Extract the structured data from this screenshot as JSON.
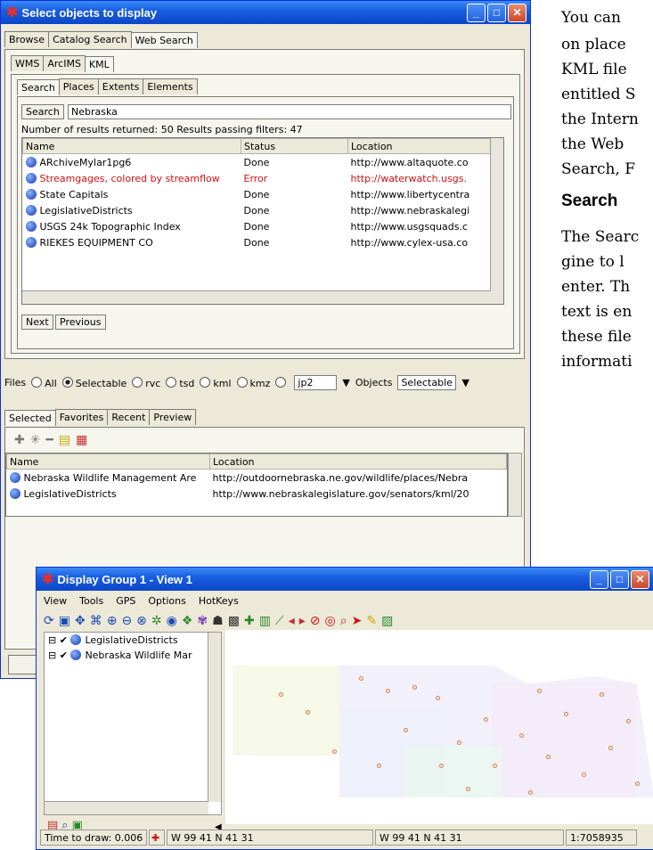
{
  "doc": {
    "lines": [
      "You can",
      "on place",
      "KML file",
      "entitled S",
      "the Intern",
      "the Web",
      "Search, F"
    ],
    "heading": "Search",
    "para": [
      "The Searc",
      "gine to l",
      "enter. Th",
      "text is en",
      "these file",
      "informati"
    ]
  },
  "win1": {
    "title": "Select objects to display",
    "tabs": [
      "Browse",
      "Catalog Search",
      "Web Search"
    ],
    "subtabs": [
      "WMS",
      "ArcIMS",
      "KML"
    ],
    "kmltabs": [
      "Search",
      "Places",
      "Extents",
      "Elements"
    ],
    "search_button": "Search",
    "search_value": "Nebraska",
    "results_info": "Number of results returned: 50   Results passing filters: 47",
    "columns": [
      "Name",
      "Status",
      "Location"
    ],
    "rows": [
      {
        "name": "ARchiveMylar1pg6",
        "status": "Done",
        "location": "http://www.altaquote.co"
      },
      {
        "name": "Streamgages, colored by streamflow",
        "status": "Error",
        "location": "http://waterwatch.usgs."
      },
      {
        "name": "State Capitals",
        "status": "Done",
        "location": "http://www.libertycentra"
      },
      {
        "name": "LegislativeDistricts",
        "status": "Done",
        "location": "http://www.nebraskalegi"
      },
      {
        "name": "USGS 24k Topographic Index",
        "status": "Done",
        "location": "http://www.usgsquads.c"
      },
      {
        "name": "RIEKES EQUIPMENT CO",
        "status": "Done",
        "location": "http://www.cylex-usa.co"
      }
    ],
    "next": "Next",
    "previous": "Previous",
    "files_label": "Files",
    "file_options": [
      "All",
      "Selectable",
      "rvc",
      "tsd",
      "kml",
      "kmz"
    ],
    "file_select": "jp2",
    "objects_label": "Objects",
    "objects_select": "Selectable",
    "lower_tabs": [
      "Selected",
      "Favorites",
      "Recent",
      "Preview"
    ],
    "lower_columns": [
      "Name",
      "Location"
    ],
    "lower_rows": [
      {
        "name": "Nebraska Wildlife Management Are",
        "location": "http://outdoornebraska.ne.gov/wildlife/places/Nebra"
      },
      {
        "name": "LegislativeDistricts",
        "location": "http://www.nebraskalegislature.gov/senators/kml/20"
      }
    ]
  },
  "win2": {
    "title": "Display Group 1 - View 1",
    "menu": [
      "View",
      "Tools",
      "GPS",
      "Options",
      "HotKeys"
    ],
    "layers": [
      "LegislativeDistricts",
      "Nebraska Wildlife Mar"
    ],
    "status": {
      "time": "Time to draw: 0.006",
      "coord1": "W 99 41  N 41 31",
      "coord2": "W 99 41  N 41 31",
      "scale": "1:7058935"
    }
  }
}
